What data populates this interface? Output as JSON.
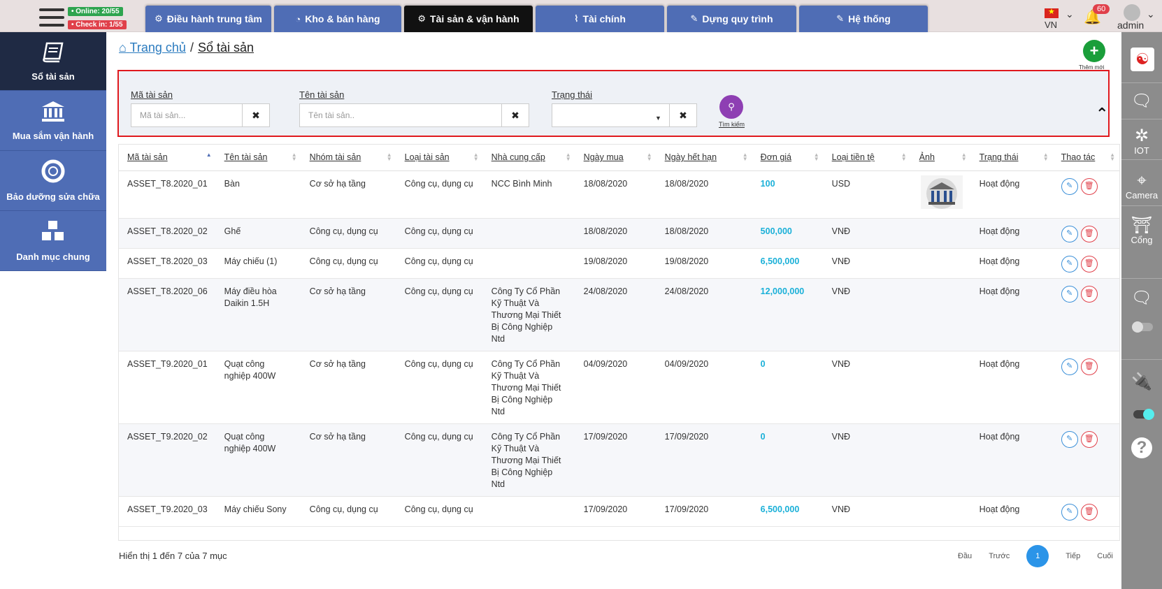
{
  "top": {
    "online": "• Online: 20/55",
    "checkin": "• Check in: 1/55",
    "tabs": [
      {
        "label": "Điều hành trung tâm",
        "icon": "gear-icon",
        "glyph": "⚙"
      },
      {
        "label": "Kho & bán hàng",
        "icon": "pie-chart-icon",
        "glyph": "◔"
      },
      {
        "label": "Tài sản & vận hành",
        "icon": "bicycle-icon",
        "glyph": "⚙"
      },
      {
        "label": "Tài chính",
        "icon": "line-chart-icon",
        "glyph": "📈"
      },
      {
        "label": "Dựng quy trình",
        "icon": "edit-icon",
        "glyph": "✎"
      },
      {
        "label": "Hệ thống",
        "icon": "edit-icon",
        "glyph": "✎"
      }
    ],
    "lang": "VN",
    "notifications": "60",
    "user": "admin"
  },
  "sidebar": {
    "items": [
      {
        "label": "Sổ tài sản",
        "icon": "book-icon",
        "glyph": "📘"
      },
      {
        "label": "Mua sắm vận hành",
        "icon": "bank-icon",
        "glyph": "🏛"
      },
      {
        "label": "Bảo dưỡng sửa chữa",
        "icon": "life-ring-icon",
        "glyph": "⭘"
      },
      {
        "label": "Danh mục chung",
        "icon": "cubes-icon",
        "glyph": "⬢"
      }
    ]
  },
  "rightbar": {
    "iot": "IOT",
    "camera": "Camera",
    "cong": "Cổng"
  },
  "breadcrumb": {
    "home": "Trang chủ",
    "current": "Sổ tài sản"
  },
  "add_label": "Thêm mới",
  "filter": {
    "code_label": "Mã tài sản",
    "code_placeholder": "Mã tài sản...",
    "name_label": "Tên tài sản",
    "name_placeholder": "Tên tài sản..",
    "status_label": "Trạng thái",
    "status_value": "",
    "search_label": "Tìm kiếm"
  },
  "table": {
    "columns": [
      "Mã tài sản",
      "Tên tài sản",
      "Nhóm tài sản",
      "Loại tài sản",
      "Nhà cung cấp",
      "Ngày mua",
      "Ngày hết hạn",
      "Đơn giá",
      "Loại tiền tệ",
      "Ảnh",
      "Trạng thái",
      "Thao tác"
    ],
    "rows": [
      {
        "code": "ASSET_T8.2020_01",
        "name": "Bàn",
        "group": "Cơ sở hạ tầng",
        "type": "Công cụ, dụng cụ",
        "supplier": "NCC Bình Minh",
        "buy": "18/08/2020",
        "expire": "18/08/2020",
        "price": "100",
        "currency": "USD",
        "image": "bank-image",
        "status": "Hoạt động"
      },
      {
        "code": "ASSET_T8.2020_02",
        "name": "Ghế",
        "group": "Công cụ, dụng cụ",
        "type": "Công cụ, dụng cụ",
        "supplier": "",
        "buy": "18/08/2020",
        "expire": "18/08/2020",
        "price": "500,000",
        "currency": "VNĐ",
        "image": "",
        "status": "Hoạt động"
      },
      {
        "code": "ASSET_T8.2020_03",
        "name": "Máy chiếu (1)",
        "group": "Công cụ, dụng cụ",
        "type": "Công cụ, dụng cụ",
        "supplier": "",
        "buy": "19/08/2020",
        "expire": "19/08/2020",
        "price": "6,500,000",
        "currency": "VNĐ",
        "image": "",
        "status": "Hoạt động"
      },
      {
        "code": "ASSET_T8.2020_06",
        "name": "Máy điều hòa Daikin 1.5H",
        "group": "Cơ sở hạ tầng",
        "type": "Công cụ, dụng cụ",
        "supplier": "Công Ty Cổ Phần Kỹ Thuật Và Thương Mại Thiết Bị Công Nghiệp Ntd",
        "buy": "24/08/2020",
        "expire": "24/08/2020",
        "price": "12,000,000",
        "currency": "VNĐ",
        "image": "",
        "status": "Hoạt động"
      },
      {
        "code": "ASSET_T9.2020_01",
        "name": "Quạt công nghiệp 400W",
        "group": "Cơ sở hạ tầng",
        "type": "Công cụ, dụng cụ",
        "supplier": "Công Ty Cổ Phần Kỹ Thuật Và Thương Mại Thiết Bị Công Nghiệp Ntd",
        "buy": "04/09/2020",
        "expire": "04/09/2020",
        "price": "0",
        "currency": "VNĐ",
        "image": "",
        "status": "Hoạt động"
      },
      {
        "code": "ASSET_T9.2020_02",
        "name": "Quạt công nghiệp 400W",
        "group": "Cơ sở hạ tầng",
        "type": "Công cụ, dụng cụ",
        "supplier": "Công Ty Cổ Phần Kỹ Thuật Và Thương Mại Thiết Bị Công Nghiệp Ntd",
        "buy": "17/09/2020",
        "expire": "17/09/2020",
        "price": "0",
        "currency": "VNĐ",
        "image": "",
        "status": "Hoạt động"
      },
      {
        "code": "ASSET_T9.2020_03",
        "name": "Máy chiếu Sony",
        "group": "Công cụ, dụng cụ",
        "type": "Công cụ, dụng cụ",
        "supplier": "",
        "buy": "17/09/2020",
        "expire": "17/09/2020",
        "price": "6,500,000",
        "currency": "VNĐ",
        "image": "",
        "status": "Hoạt động"
      }
    ]
  },
  "footer": {
    "info": "Hiển thị 1 đến 7 của 7 mục",
    "first": "Đầu",
    "prev": "Trước",
    "page": "1",
    "next": "Tiếp",
    "last": "Cuối"
  },
  "colors": {
    "nav_blue": "#4f6db5",
    "active_dark": "#111111",
    "price_cyan": "#1ab0d8",
    "filter_border": "#e0191e"
  }
}
